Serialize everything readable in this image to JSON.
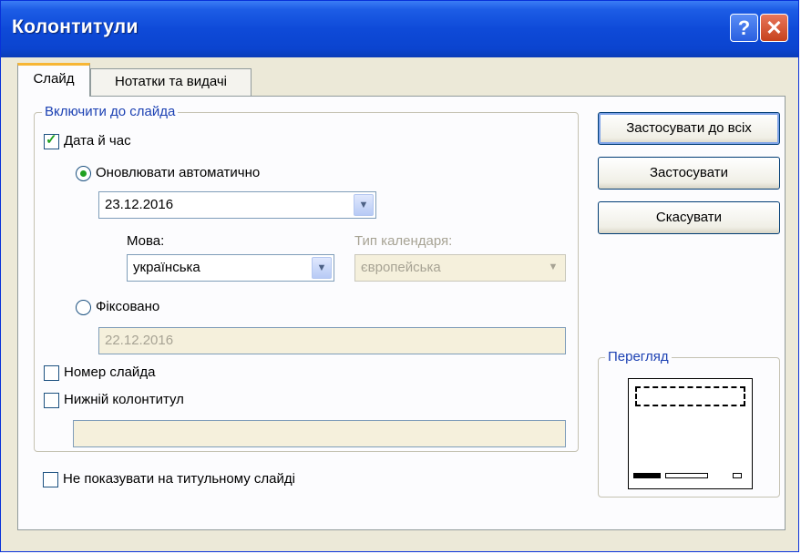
{
  "window": {
    "title": "Колонтитули",
    "help_glyph": "?",
    "close_glyph": "✕"
  },
  "tabs": [
    {
      "label": "Слайд",
      "active": true
    },
    {
      "label": "Нотатки та видачі",
      "active": false
    }
  ],
  "include_group": {
    "label": "Включити до слайда",
    "date_time": {
      "label": "Дата й час",
      "checked": true
    },
    "auto_update": {
      "label": "Оновлювати автоматично",
      "selected": true
    },
    "date_value": "23.12.2016",
    "language": {
      "label": "Мова:",
      "value": "українська"
    },
    "calendar_type": {
      "label": "Тип календаря:",
      "value": "європейська",
      "disabled": true
    },
    "fixed": {
      "label": "Фіксовано",
      "selected": false
    },
    "fixed_value": "22.12.2016",
    "slide_number": {
      "label": "Номер слайда",
      "checked": false
    },
    "footer": {
      "label": "Нижній колонтитул",
      "checked": false
    },
    "footer_value": ""
  },
  "hide_on_title": {
    "label": "Не показувати на титульному слайді",
    "checked": false
  },
  "buttons": {
    "apply_all": "Застосувати до всіх",
    "apply": "Застосувати",
    "cancel": "Скасувати"
  },
  "preview": {
    "label": "Перегляд"
  },
  "icons": {
    "checkmark": "✓",
    "dropdown": "▼"
  },
  "colors": {
    "title_bar": "#0e4ad8",
    "group_label": "#1c41b3",
    "accent": "#21a121"
  }
}
